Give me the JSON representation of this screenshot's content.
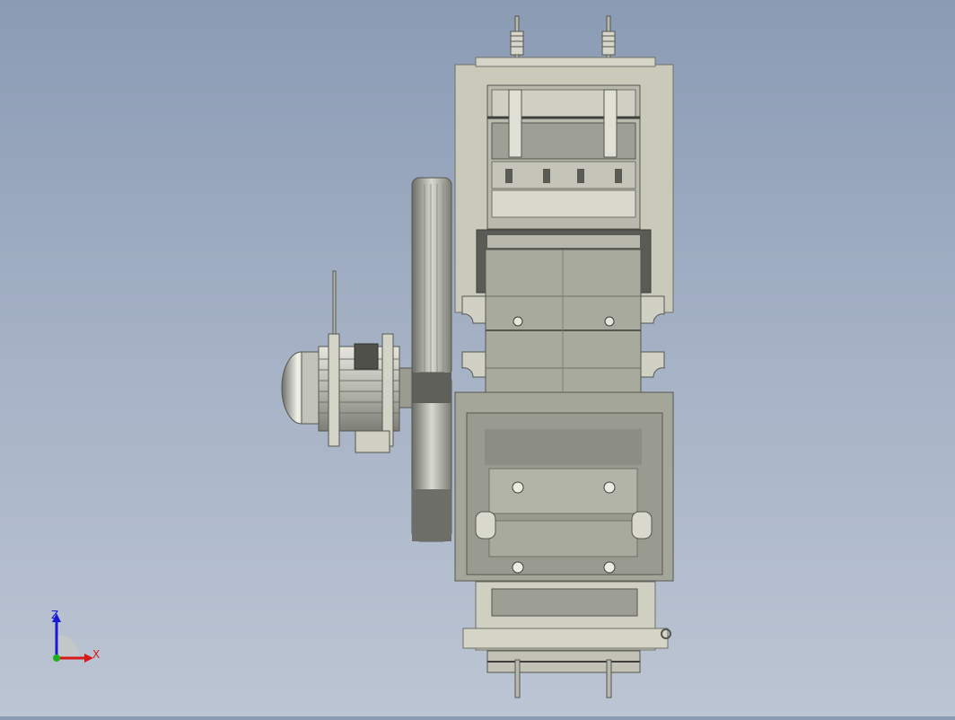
{
  "scene": {
    "background_top": "#8a9bb4",
    "background_bottom": "#bcc5d3",
    "model_color": "#c9c9bb",
    "model_shadow": "#8e8f84",
    "model_dark": "#5a5b55"
  },
  "triad": {
    "z_label": "Z",
    "x_label": "X",
    "x_color": "#d61a1a",
    "z_color": "#1a1ad6",
    "y_color": "#1ab21a"
  }
}
